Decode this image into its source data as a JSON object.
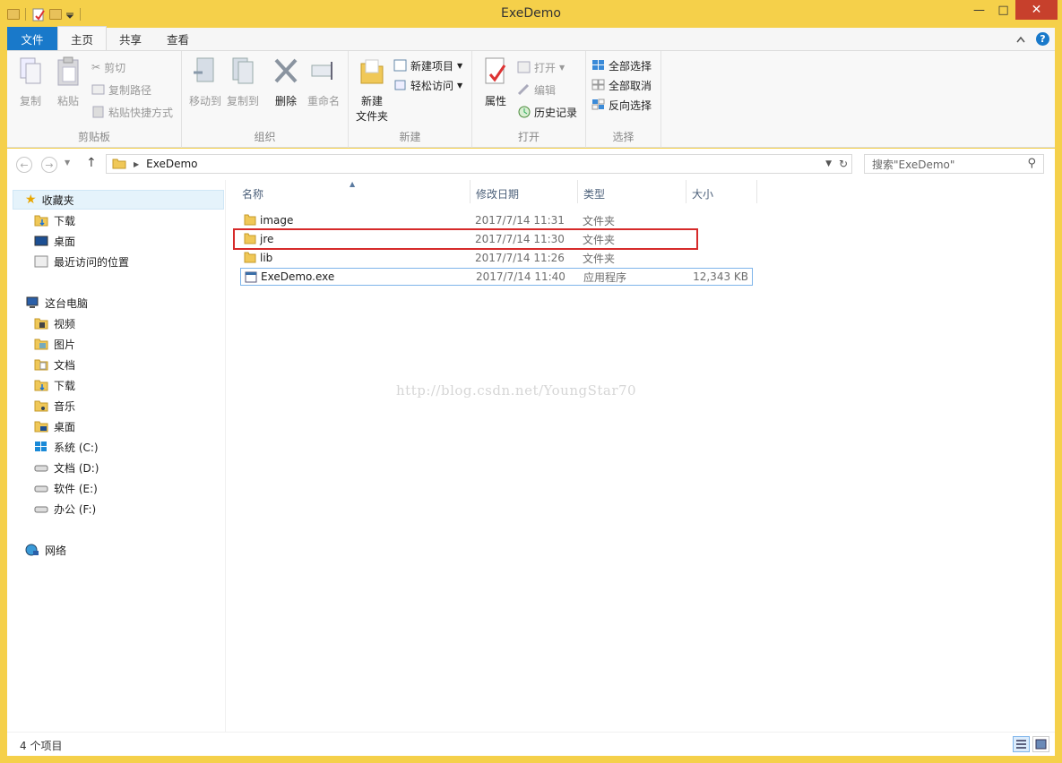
{
  "window": {
    "title": "ExeDemo"
  },
  "titlebar": {
    "minimize": "—",
    "maximize": "□",
    "close": "✕"
  },
  "tabs": {
    "file": "文件",
    "home": "主页",
    "share": "共享",
    "view": "查看"
  },
  "ribbon": {
    "clipboard": {
      "label": "剪贴板",
      "copy": "复制",
      "paste": "粘贴",
      "cut": "剪切",
      "copy_path": "复制路径",
      "paste_shortcut": "粘贴快捷方式"
    },
    "organize": {
      "label": "组织",
      "move_to": "移动到",
      "copy_to": "复制到",
      "delete": "删除",
      "rename": "重命名"
    },
    "new": {
      "label": "新建",
      "new_folder_line1": "新建",
      "new_folder_line2": "文件夹",
      "new_item": "新建项目",
      "easy_access": "轻松访问"
    },
    "open": {
      "label": "打开",
      "properties": "属性",
      "open": "打开",
      "edit": "编辑",
      "history": "历史记录"
    },
    "select": {
      "label": "选择",
      "select_all": "全部选择",
      "select_none": "全部取消",
      "invert": "反向选择"
    }
  },
  "address": {
    "path": "ExeDemo",
    "search_placeholder": "搜索\"ExeDemo\""
  },
  "nav": {
    "favorites": "收藏夹",
    "downloads": "下载",
    "desktop": "桌面",
    "recent": "最近访问的位置",
    "this_pc": "这台电脑",
    "videos": "视频",
    "pictures": "图片",
    "documents": "文档",
    "downloads2": "下载",
    "music": "音乐",
    "desktop2": "桌面",
    "drive_c": "系统 (C:)",
    "drive_d": "文档 (D:)",
    "drive_e": "软件 (E:)",
    "drive_f": "办公 (F:)",
    "network": "网络"
  },
  "columns": {
    "name": "名称",
    "date": "修改日期",
    "type": "类型",
    "size": "大小"
  },
  "files": [
    {
      "name": "image",
      "date": "2017/7/14 11:31",
      "type": "文件夹",
      "size": ""
    },
    {
      "name": "jre",
      "date": "2017/7/14 11:30",
      "type": "文件夹",
      "size": ""
    },
    {
      "name": "lib",
      "date": "2017/7/14 11:26",
      "type": "文件夹",
      "size": ""
    },
    {
      "name": "ExeDemo.exe",
      "date": "2017/7/14 11:40",
      "type": "应用程序",
      "size": "12,343 KB"
    }
  ],
  "watermark": "http://blog.csdn.net/YoungStar70",
  "status": {
    "count": "4 个项目"
  },
  "colors": {
    "accent": "#1979ca",
    "frame": "#f5d04a",
    "highlight": "#d62a2a"
  }
}
